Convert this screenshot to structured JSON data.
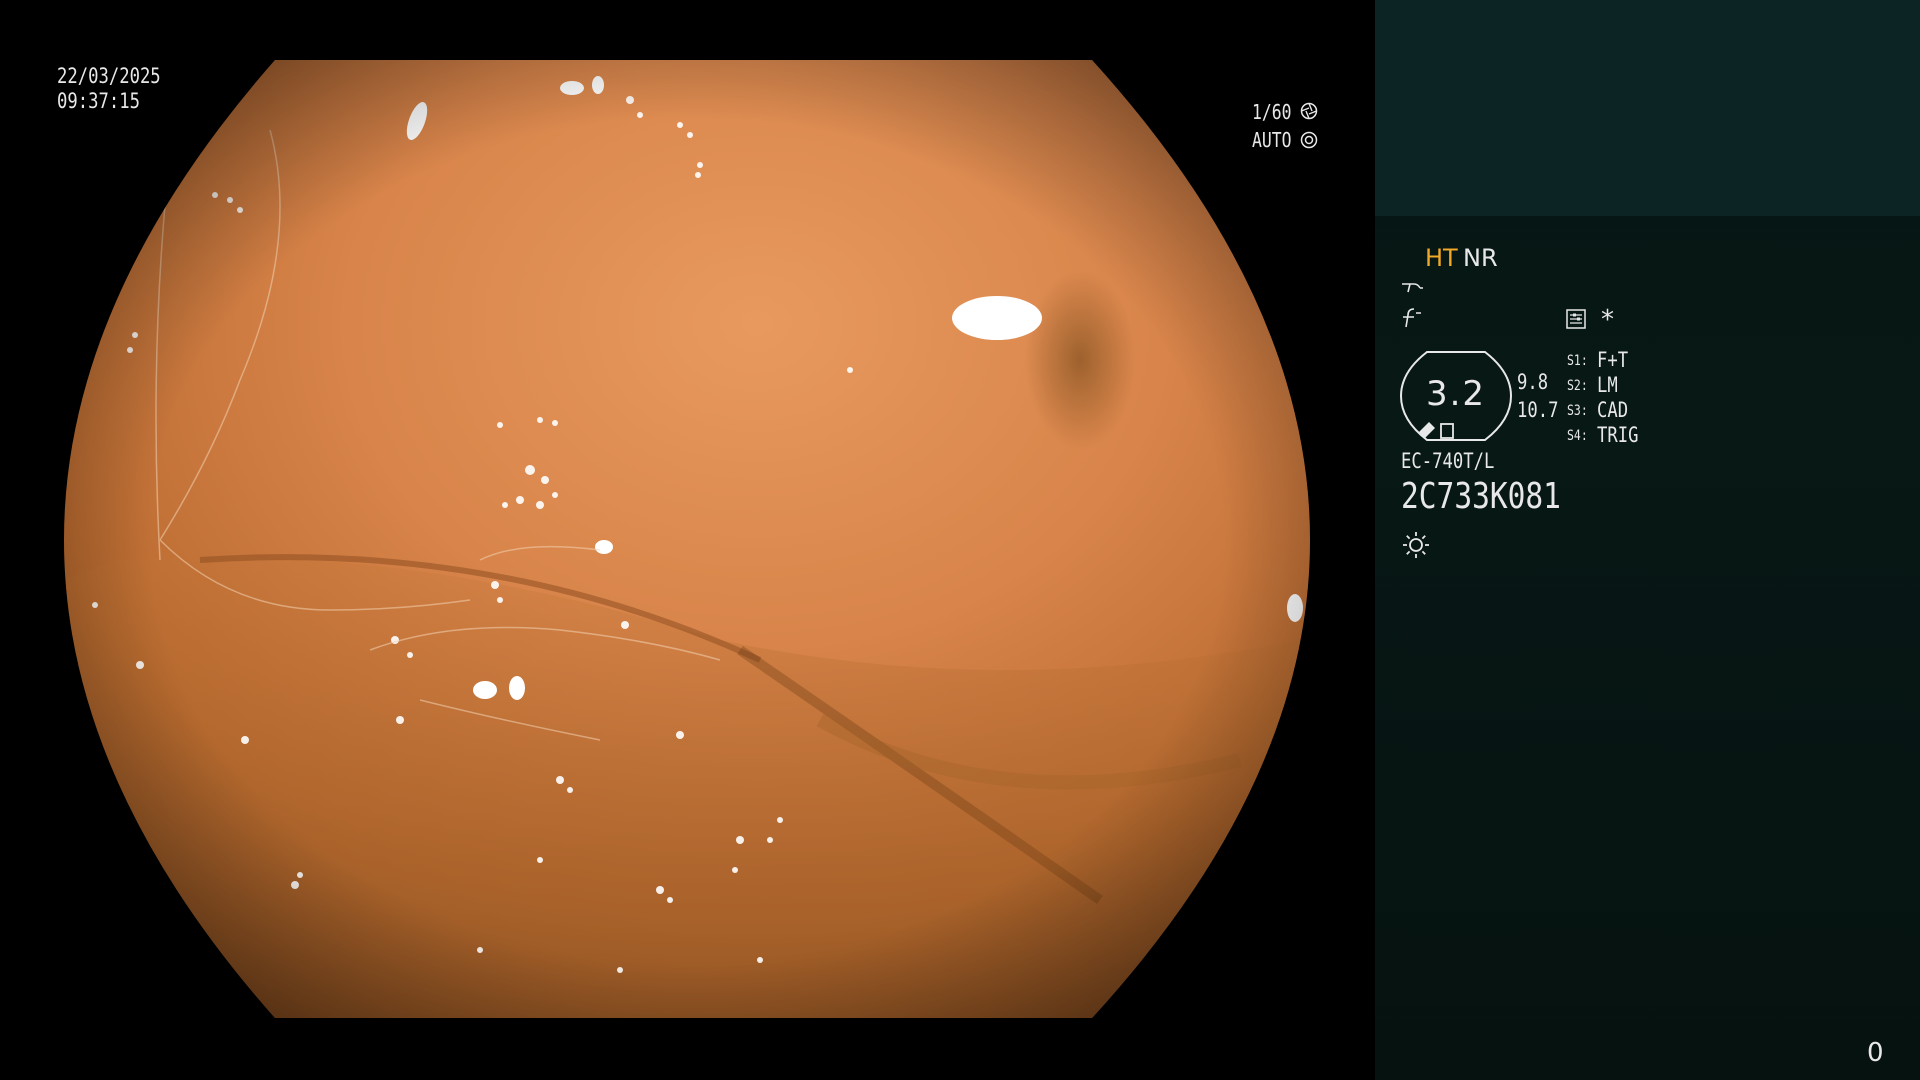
{
  "overlay": {
    "date": "22/03/2025",
    "time": "09:37:15",
    "shutter": "1/60",
    "iris_mode": "AUTO"
  },
  "icons": {
    "shutter_icon": "shutter-icon",
    "iris_icon": "iris-icon",
    "stiffness_icon": "stiffness-icon",
    "curve_icon": "curve-icon",
    "settings_icon": "settings-icon",
    "lamp_icon": "lamp-icon"
  },
  "panel": {
    "mode_ht": "HT",
    "mode_nr": "NR",
    "asterisk": "*",
    "zoom_value": "3.2",
    "values": [
      "9.8",
      "10.7"
    ],
    "switches": [
      {
        "key": "S1:",
        "value": "F+T"
      },
      {
        "key": "S2:",
        "value": "LM"
      },
      {
        "key": "S3:",
        "value": "CAD"
      },
      {
        "key": "S4:",
        "value": "TRIG"
      }
    ],
    "scope_model": "EC-740T/L",
    "serial": "2C733K081",
    "counter": "0"
  },
  "colors": {
    "mode_ht": "#f2a828",
    "panel_bg": "#061513",
    "panel_top": "#0d2425",
    "text": "#e8e8e8"
  }
}
